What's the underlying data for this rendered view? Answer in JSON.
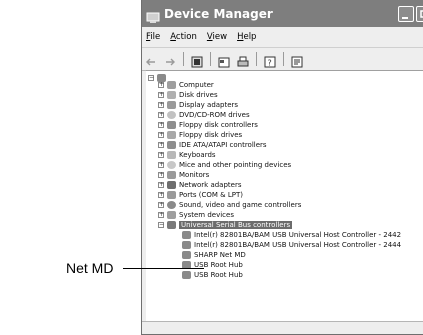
{
  "window": {
    "title": "Device Manager"
  },
  "menu": [
    {
      "label": "File",
      "underline": "F",
      "rest": "ile"
    },
    {
      "label": "Action",
      "underline": "A",
      "rest": "ction"
    },
    {
      "label": "View",
      "underline": "V",
      "rest": "iew"
    },
    {
      "label": "Help",
      "underline": "H",
      "rest": "elp"
    }
  ],
  "toolbar_icons": [
    "back-arrow-icon",
    "forward-arrow-icon",
    "view-icon",
    "properties-icon",
    "print-icon",
    "help-icon",
    "scan-icon"
  ],
  "tree": {
    "root": "",
    "categories": [
      "Computer",
      "Disk drives",
      "Display adapters",
      "DVD/CD-ROM drives",
      "Floppy disk controllers",
      "Floppy disk drives",
      "IDE ATA/ATAPI controllers",
      "Keyboards",
      "Mice and other pointing devices",
      "Monitors",
      "Network adapters",
      "Ports (COM & LPT)",
      "Sound, video and game controllers",
      "System devices",
      "Universal Serial Bus controllers"
    ],
    "usb_children": [
      "Intel(r) 82801BA/BAM USB Universal Host Controller - 2442",
      "Intel(r) 82801BA/BAM USB Universal Host Controller - 2444",
      "SHARP Net MD",
      "USB Root Hub",
      "USB Root Hub"
    ]
  },
  "callout": {
    "label": "Net MD"
  }
}
